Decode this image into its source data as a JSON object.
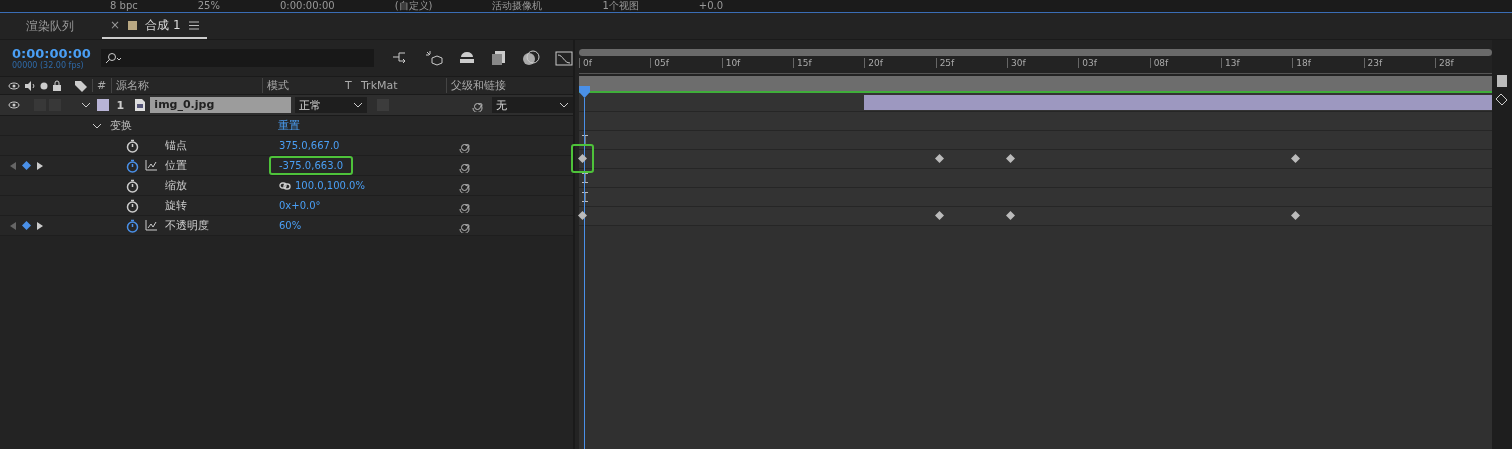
{
  "toolbar": [
    "8 bpc",
    "25%",
    "0:00:00:00",
    "(自定义)",
    "活动摄像机",
    "1个视图",
    "+0.0"
  ],
  "tabs": [
    {
      "label": "渲染队列",
      "selected": false
    },
    {
      "label": "合成 1",
      "selected": true,
      "close": "×"
    }
  ],
  "timecode": "0:00:00:00",
  "frame_info": "00000 (32.00 fps)",
  "columns": [
    "#",
    "源名称",
    "模式",
    "T",
    "TrkMat",
    "父级和链接"
  ],
  "layer": {
    "number": "1",
    "name": "img_0.jpg",
    "mode": "正常",
    "parent": "无",
    "visible": true,
    "expanded": true
  },
  "group": {
    "name": "变换",
    "reset": "重置",
    "expanded": true
  },
  "properties": [
    {
      "name": "锚点",
      "value": "375.0,667.0",
      "animated": false,
      "linked": false,
      "highlight": false
    },
    {
      "name": "位置",
      "value": "-375.0,663.0",
      "animated": true,
      "linked": false,
      "highlight": true
    },
    {
      "name": "缩放",
      "value": "100.0,100.0%",
      "animated": false,
      "linked": true,
      "highlight": false
    },
    {
      "name": "旋转",
      "value": "0x+0.0°",
      "animated": false,
      "linked": false,
      "highlight": false
    },
    {
      "name": "不透明度",
      "value": "60%",
      "animated": true,
      "linked": false,
      "highlight": false
    }
  ],
  "ruler": [
    "0f",
    "05f",
    "10f",
    "15f",
    "20f",
    "25f",
    "30f",
    "03f",
    "08f",
    "13f",
    "18f",
    "23f",
    "28f"
  ]
}
